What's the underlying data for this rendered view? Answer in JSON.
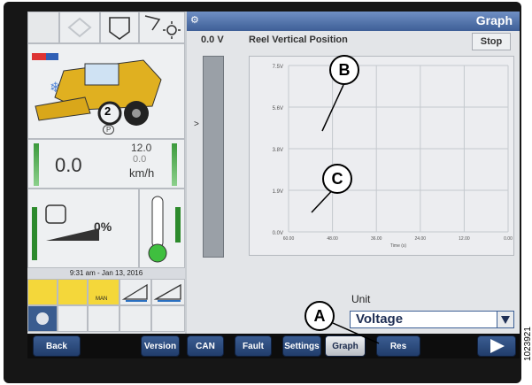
{
  "left_panel": {
    "speed_value": "0.0",
    "speed_max": "12.0",
    "speed_min": "0.0",
    "speed_unit": "km/h",
    "gear": "2",
    "park_label": "P",
    "fuel_percent": "0%",
    "datetime": "9:31 am - Jan 13, 2016",
    "man_label": "MAN"
  },
  "graph_panel": {
    "window_title": "Graph",
    "current_value": "0.0 V",
    "graph_title": "Reel Vertical Position",
    "stop_label": "Stop",
    "unit_label": "Unit",
    "unit_value": "Voltage",
    "gauge_marker": ">"
  },
  "chart_data": {
    "type": "line",
    "title": "Reel Vertical Position",
    "xlabel": "Time (s)",
    "ylabel": "",
    "y_ticks": [
      "7.5V",
      "5.6V",
      "3.8V",
      "1.9V",
      "0.0V"
    ],
    "x_ticks": [
      "60.00",
      "48.00",
      "36.00",
      "24.00",
      "12.00",
      "0.00"
    ],
    "ylim": [
      0,
      7.5
    ],
    "grid": true,
    "series": []
  },
  "bottom_bar": {
    "buttons": [
      "Back",
      "Version",
      "CAN",
      "Fault",
      "Settings",
      "Graph",
      "Res"
    ],
    "active": "Graph"
  },
  "callouts": {
    "a": "A",
    "b": "B",
    "c": "C"
  },
  "doc_number": "1023921"
}
